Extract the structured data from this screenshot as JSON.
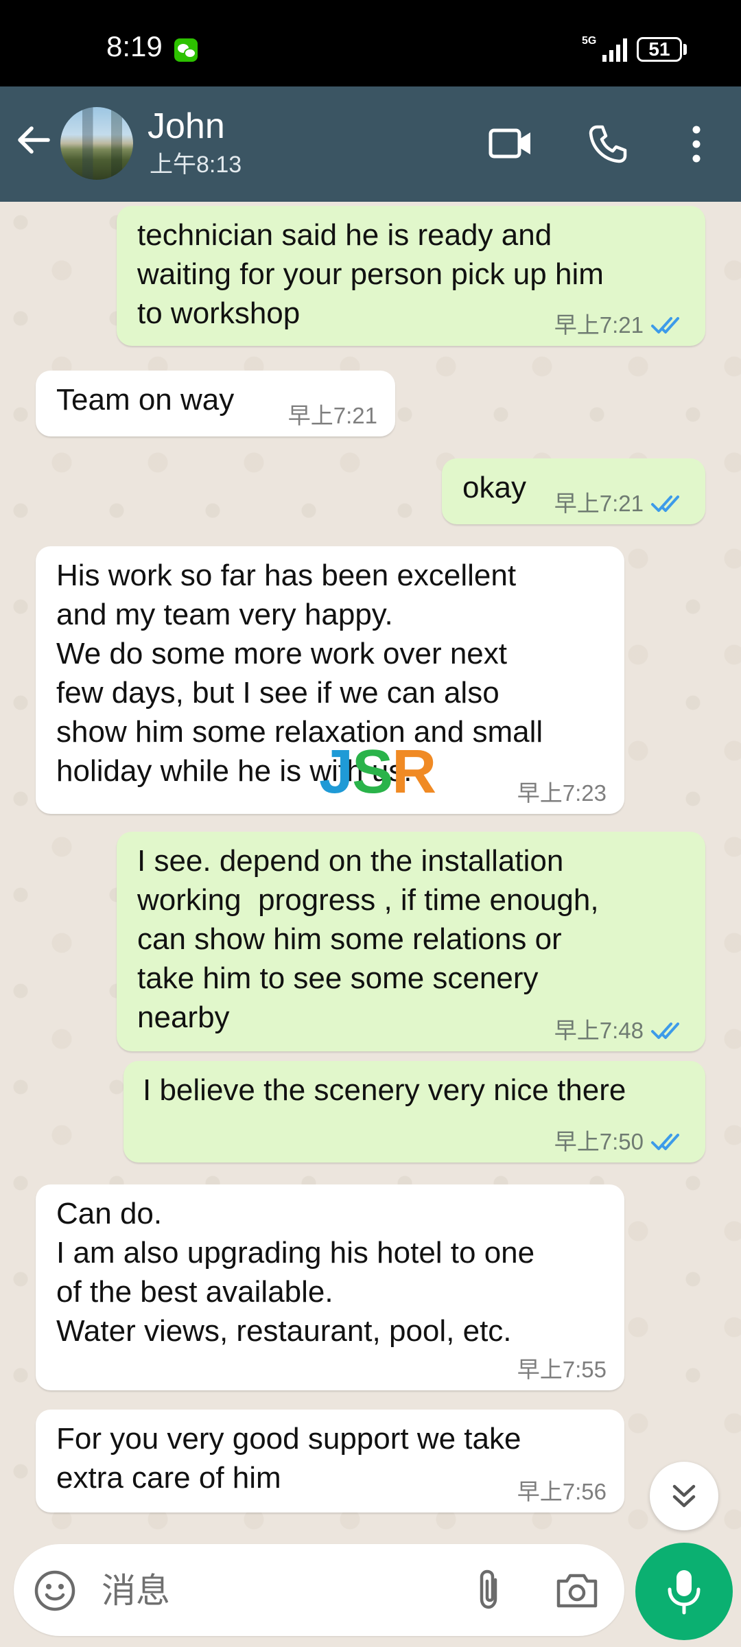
{
  "status_bar": {
    "time": "8:19",
    "network": "5G",
    "battery": "51",
    "wechat_icon": "wechat-icon"
  },
  "header": {
    "contact_name": "John",
    "last_seen": "上午8:13",
    "icons": [
      "back-arrow-icon",
      "video-call-icon",
      "phone-call-icon",
      "more-options-icon"
    ],
    "bg_color": "#3b5563"
  },
  "messages": [
    {
      "direction": "out",
      "text": "technician said he is ready and\nwaiting for your person pick up him\nto workshop",
      "time": "早上7:21",
      "read": true
    },
    {
      "direction": "in",
      "text": "Team on way",
      "time": "早上7:21"
    },
    {
      "direction": "out",
      "text": "okay",
      "time": "早上7:21",
      "read": true
    },
    {
      "direction": "in",
      "text": "His work so far has been excellent\nand my team very happy.\nWe do some more work over next\nfew days, but I see if we can also\nshow him some relaxation and small\nholiday while he is with us.",
      "time": "早上7:23"
    },
    {
      "direction": "out",
      "text": "I see. depend on the installation\nworking  progress , if time enough,\ncan show him some relations or\ntake him to see some scenery\nnearby",
      "time": "早上7:48",
      "read": true
    },
    {
      "direction": "out",
      "text": "I believe the scenery very nice there",
      "time": "早上7:50",
      "read": true
    },
    {
      "direction": "in",
      "text": "Can do.\nI am also upgrading his hotel to one\nof the best available.\nWater views, restaurant, pool, etc.",
      "time": "早上7:55"
    },
    {
      "direction": "in",
      "text": "For you very good support we take\nextra care of him",
      "time": "早上7:56"
    }
  ],
  "watermark": {
    "letters": [
      "J",
      "S",
      "R"
    ],
    "colors": [
      "#1f9ad6",
      "#2ab34a",
      "#f08a24"
    ]
  },
  "input": {
    "placeholder": "消息"
  },
  "colors": {
    "outgoing_bubble": "#e1f7cb",
    "incoming_bubble": "#ffffff",
    "read_ticks": "#3d9be9",
    "accent": "#0bb071"
  }
}
